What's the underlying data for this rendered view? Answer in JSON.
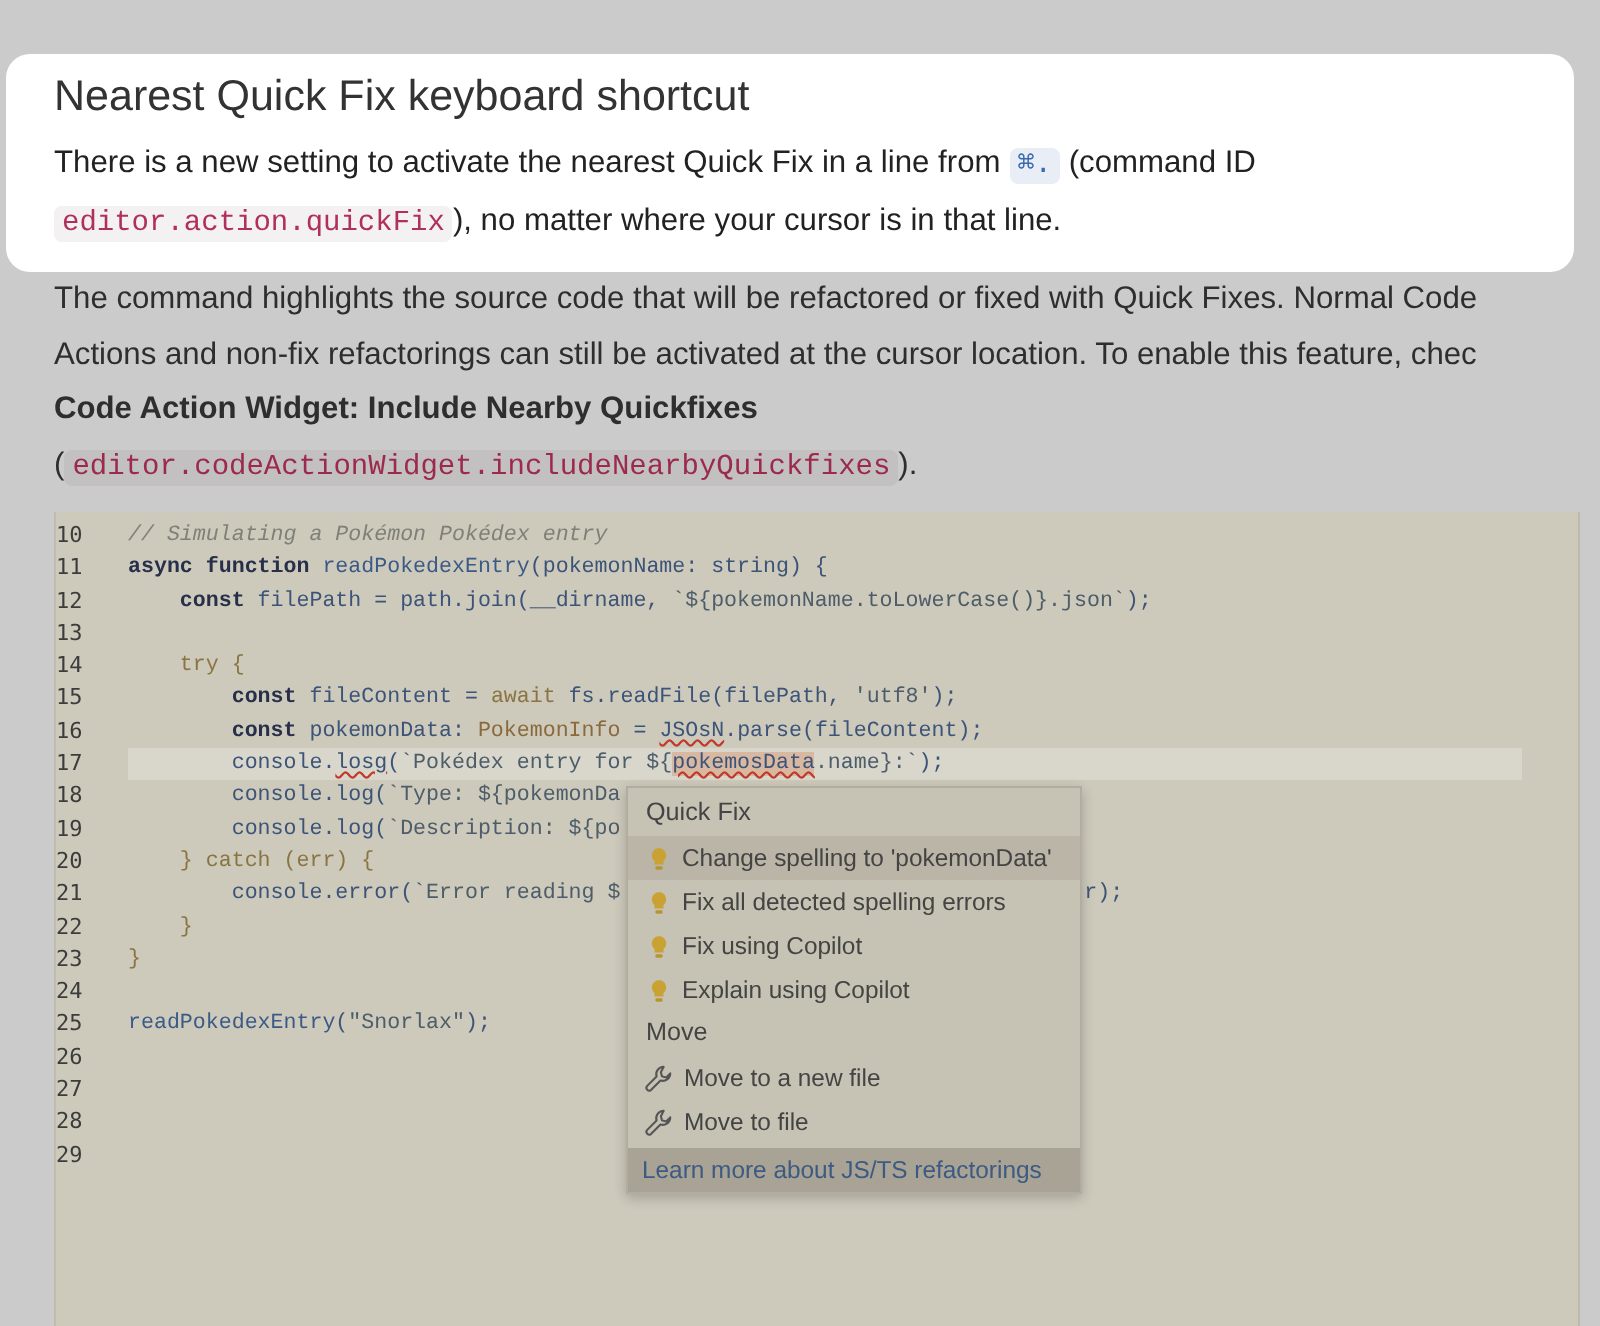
{
  "card": {
    "title": "Nearest Quick Fix keyboard shortcut",
    "paragraph": [
      {
        "kind": "text",
        "text": "There is a new setting to activate the nearest Quick Fix in a line from "
      },
      {
        "kind": "key",
        "text": "⌘."
      },
      {
        "kind": "text",
        "text": " (command ID "
      },
      {
        "kind": "code",
        "text": "editor.action.quickFix"
      },
      {
        "kind": "text",
        "text": "), no matter where your cursor is in that line."
      }
    ]
  },
  "description": [
    {
      "kind": "text",
      "segments": [
        {
          "kind": "text",
          "text": "The command highlights the source code that will be refactored or fixed with Quick Fixes. Normal Code"
        }
      ]
    },
    {
      "kind": "text",
      "segments": [
        {
          "kind": "text",
          "text": "Actions and non-fix refactorings can still be activated at the cursor location. To enable this feature, chec"
        }
      ]
    },
    {
      "kind": "bold",
      "segments": [
        {
          "kind": "text",
          "text": "Code Action Widget: Include Nearby Quickfixes"
        }
      ]
    },
    {
      "kind": "text",
      "segments": [
        {
          "kind": "text",
          "text": "("
        },
        {
          "kind": "code",
          "text": "editor.codeActionWidget.includeNearbyQuickfixes"
        },
        {
          "kind": "text",
          "text": ")."
        }
      ]
    }
  ],
  "editor": {
    "lines": [
      {
        "number": "10",
        "current": false,
        "tokens": [
          {
            "kind": "comment",
            "text": "// Simulating a Pokémon Pokédex entry"
          }
        ]
      },
      {
        "number": "11",
        "current": false,
        "tokens": [
          {
            "kind": "keyword",
            "text": "async function "
          },
          {
            "kind": "function",
            "text": "readPokedexEntry"
          },
          {
            "kind": "ident",
            "text": "(pokemonName: string) {"
          }
        ]
      },
      {
        "number": "12",
        "current": false,
        "tokens": [
          {
            "kind": "keyword",
            "text": "    const "
          },
          {
            "kind": "ident",
            "text": "filePath = path.join(__dirname, "
          },
          {
            "kind": "string",
            "text": "`${pokemonName.toLowerCase()}.json`"
          },
          {
            "kind": "ident",
            "text": ");"
          }
        ]
      },
      {
        "number": "13",
        "current": false
      },
      {
        "number": "14",
        "current": false,
        "tokens": [
          {
            "kind": "control",
            "text": "    try {"
          }
        ]
      },
      {
        "number": "15",
        "current": false,
        "tokens": [
          {
            "kind": "keyword",
            "text": "        const "
          },
          {
            "kind": "ident",
            "text": "fileContent = "
          },
          {
            "kind": "control",
            "text": "await "
          },
          {
            "kind": "ident",
            "text": "fs.readFile(filePath, "
          },
          {
            "kind": "string",
            "text": "'utf8'"
          },
          {
            "kind": "ident",
            "text": ");"
          }
        ]
      },
      {
        "number": "16",
        "current": false,
        "tokens": [
          {
            "kind": "keyword",
            "text": "        const "
          },
          {
            "kind": "ident",
            "text": "pokemonData: "
          },
          {
            "kind": "type",
            "text": "PokemonInfo"
          },
          {
            "kind": "ident",
            "text": " = "
          },
          {
            "kind": "error",
            "text": "JSOsN"
          },
          {
            "kind": "ident",
            "text": ".parse(fileContent);"
          }
        ]
      },
      {
        "number": "17",
        "current": true,
        "tokens": [
          {
            "kind": "ident",
            "text": "        console."
          },
          {
            "kind": "error",
            "text": "losg"
          },
          {
            "kind": "ident",
            "text": "("
          },
          {
            "kind": "string",
            "text": "`Pokédex entry for ${"
          },
          {
            "kind": "error-match",
            "text": "pokemosData"
          },
          {
            "kind": "string",
            "text": ".name}:`"
          },
          {
            "kind": "ident",
            "text": ");"
          }
        ]
      },
      {
        "number": "18",
        "current": false,
        "tokens": [
          {
            "kind": "ident",
            "text": "        console.log("
          },
          {
            "kind": "string",
            "text": "`Type: ${pokemonDa"
          }
        ]
      },
      {
        "number": "19",
        "current": false,
        "tokens": [
          {
            "kind": "ident",
            "text": "        console.log("
          },
          {
            "kind": "string",
            "text": "`Description: ${po"
          }
        ]
      },
      {
        "number": "20",
        "current": false,
        "tokens": [
          {
            "kind": "control",
            "text": "    } catch (err) {"
          }
        ]
      },
      {
        "number": "21",
        "current": false,
        "tokens": [
          {
            "kind": "ident",
            "text": "        console.error("
          },
          {
            "kind": "string",
            "text": "`Error reading $"
          }
        ],
        "after_menu": [
          {
            "kind": "ident",
            "text": "r);"
          }
        ]
      },
      {
        "number": "22",
        "current": false,
        "tokens": [
          {
            "kind": "control",
            "text": "    }"
          }
        ]
      },
      {
        "number": "23",
        "current": false,
        "tokens": [
          {
            "kind": "control",
            "text": "}"
          }
        ]
      },
      {
        "number": "24",
        "current": false
      },
      {
        "number": "25",
        "current": false,
        "tokens": [
          {
            "kind": "function",
            "text": "readPokedexEntry"
          },
          {
            "kind": "ident",
            "text": "("
          },
          {
            "kind": "string",
            "text": "\"Snorlax\""
          },
          {
            "kind": "ident",
            "text": ");"
          }
        ]
      },
      {
        "number": "26",
        "current": false
      },
      {
        "number": "27",
        "current": false
      },
      {
        "number": "28",
        "current": false
      },
      {
        "number": "29",
        "current": false
      }
    ],
    "quick_fix_menu": {
      "items": [
        {
          "kind": "section",
          "label": "Quick Fix"
        },
        {
          "kind": "fix",
          "label": "Change spelling to 'pokemonData'",
          "selected": true
        },
        {
          "kind": "fix",
          "label": "Fix all detected spelling errors",
          "selected": false
        },
        {
          "kind": "fix",
          "label": "Fix using Copilot",
          "selected": false
        },
        {
          "kind": "fix",
          "label": "Explain using Copilot",
          "selected": false
        },
        {
          "kind": "section",
          "label": "Move"
        },
        {
          "kind": "refactor",
          "label": "Move to a new file",
          "selected": false
        },
        {
          "kind": "refactor",
          "label": "Move to file",
          "selected": false
        },
        {
          "kind": "link",
          "label": "Learn more about JS/TS refactorings"
        }
      ]
    }
  }
}
